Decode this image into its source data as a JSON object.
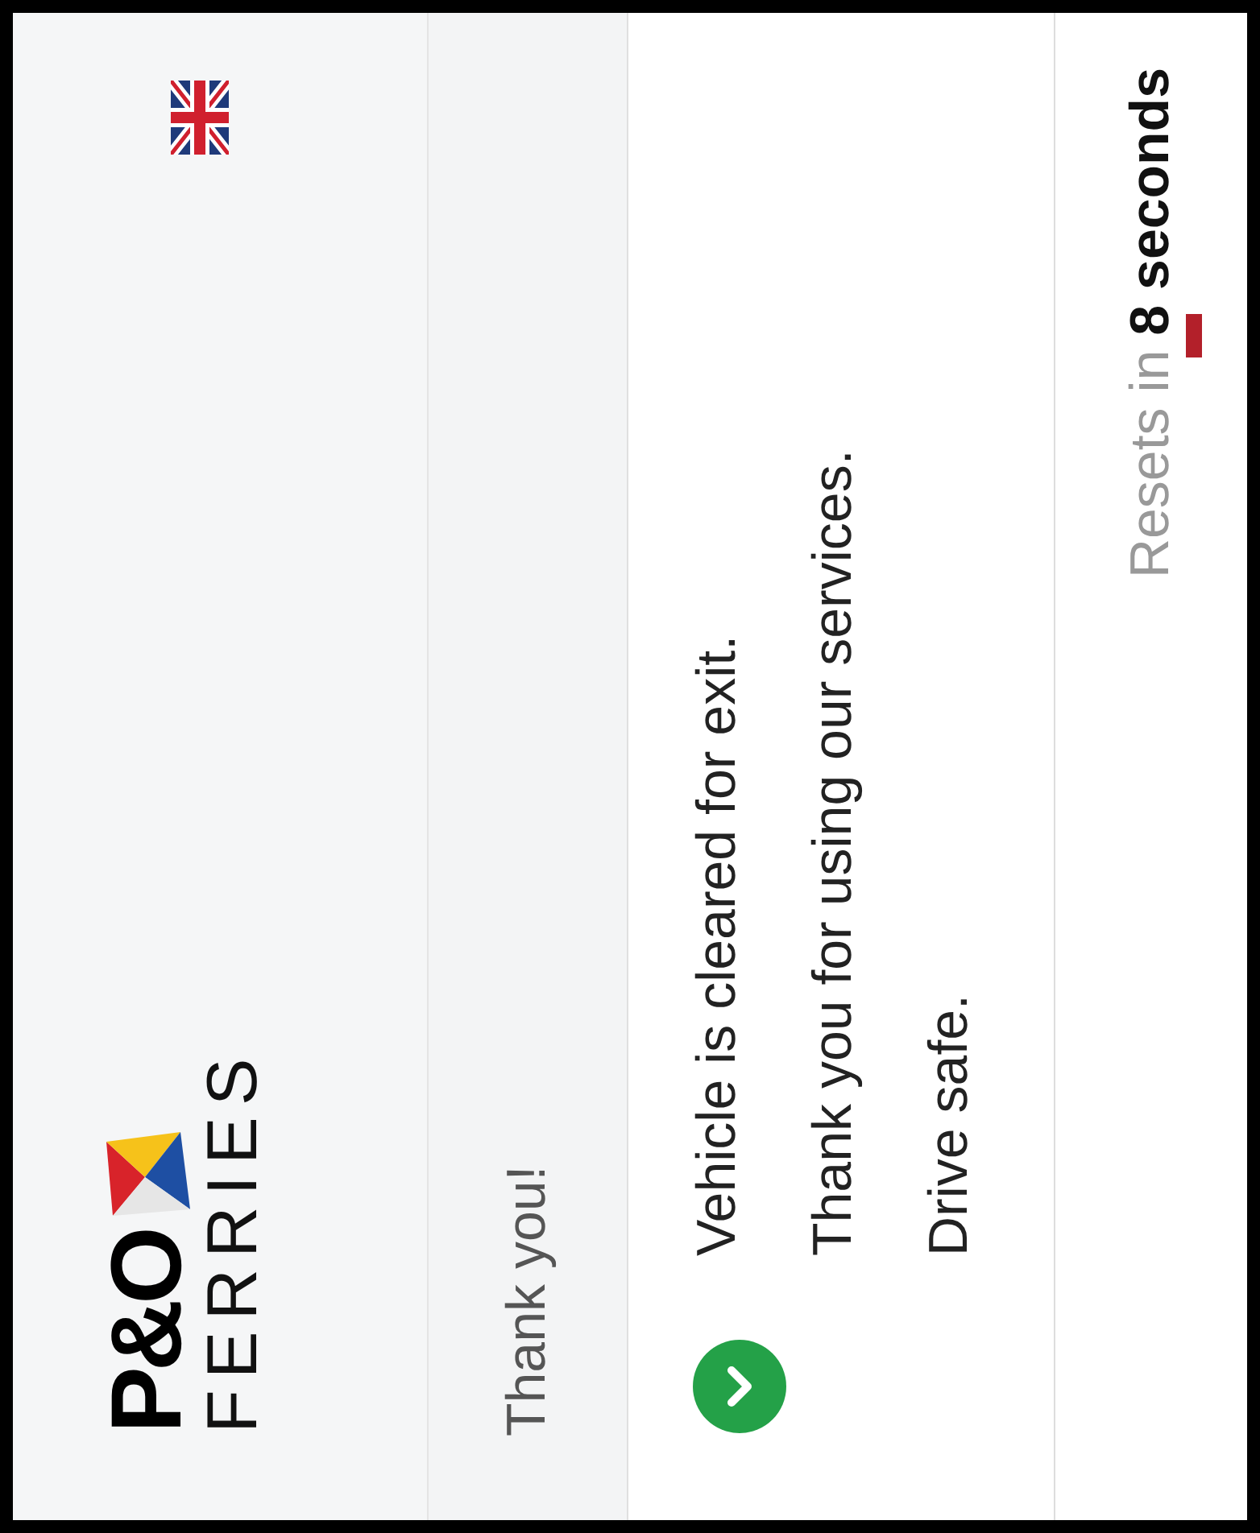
{
  "header": {
    "logo": {
      "brand": "P&O",
      "subtitle": "FERRIES"
    }
  },
  "heading": "Thank you!",
  "message": {
    "lines": [
      "Vehicle is cleared for exit.",
      "Thank you for using our services.",
      "Drive safe."
    ]
  },
  "footer": {
    "prefix": "Resets in",
    "countdown": "8 seconds"
  }
}
